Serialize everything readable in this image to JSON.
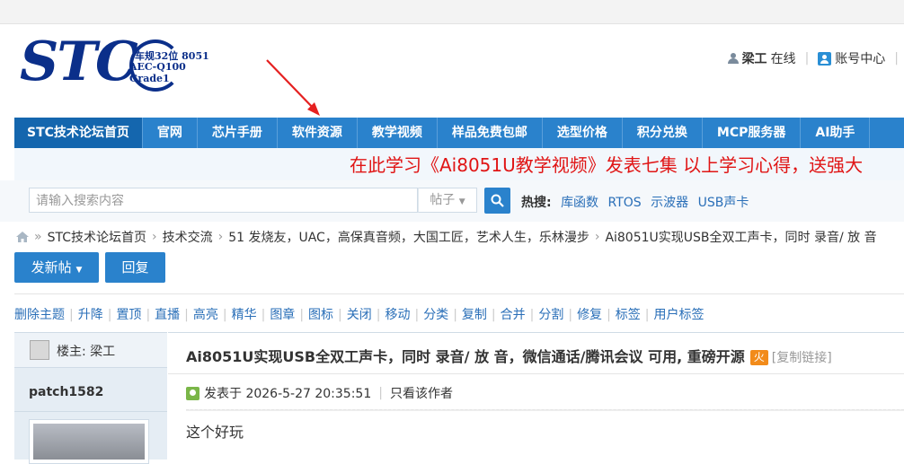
{
  "logo": {
    "brand": "STC",
    "line1": "车规32位 8051",
    "line2": "AEC-Q100 Grade1"
  },
  "user": {
    "name": "梁工",
    "status": "在线",
    "account": "账号中心"
  },
  "nav": [
    {
      "label": "STC技术论坛首页"
    },
    {
      "label": "官网"
    },
    {
      "label": "芯片手册"
    },
    {
      "label": "软件资源"
    },
    {
      "label": "教学视频"
    },
    {
      "label": "样品免费包邮"
    },
    {
      "label": "选型价格"
    },
    {
      "label": "积分兑换"
    },
    {
      "label": "MCP服务器"
    },
    {
      "label": "AI助手"
    }
  ],
  "marquee": "在此学习《Ai8051U教学视频》发表七集 以上学习心得，送强大",
  "search": {
    "placeholder": "请输入搜索内容",
    "type": "帖子"
  },
  "hot": {
    "label": "热搜:",
    "items": [
      "库函数",
      "RTOS",
      "示波器",
      "USB声卡"
    ]
  },
  "breadcrumb": [
    "STC技术论坛首页",
    "技术交流",
    "51 发烧友，UAC，高保真音频，大国工匠，艺术人生，乐林漫步",
    "Ai8051U实现USB全双工声卡，同时 录音/ 放 音"
  ],
  "actions": {
    "post": "发新帖",
    "reply": "回复"
  },
  "mod_tools": [
    "删除主题",
    "升降",
    "置顶",
    "直播",
    "高亮",
    "精华",
    "图章",
    "图标",
    "关闭",
    "移动",
    "分类",
    "复制",
    "合并",
    "分割",
    "修复",
    "标签",
    "用户标签"
  ],
  "author": {
    "louzhu": "楼主: 梁工",
    "name": "patch1582"
  },
  "post": {
    "title": "Ai8051U实现USB全双工声卡，同时 录音/ 放 音，微信通话/腾讯会议 可用, 重磅开源",
    "hot_badge": "火",
    "copy_link": "[复制链接]",
    "posted": "发表于 2026-5-27 20:35:51",
    "only_author": "只看该作者",
    "body": "这个好玩"
  },
  "colors": {
    "nav": "#2a82cc",
    "nav_active": "#1466ae",
    "marquee_text": "#e01515",
    "link": "#2a6fb8"
  }
}
